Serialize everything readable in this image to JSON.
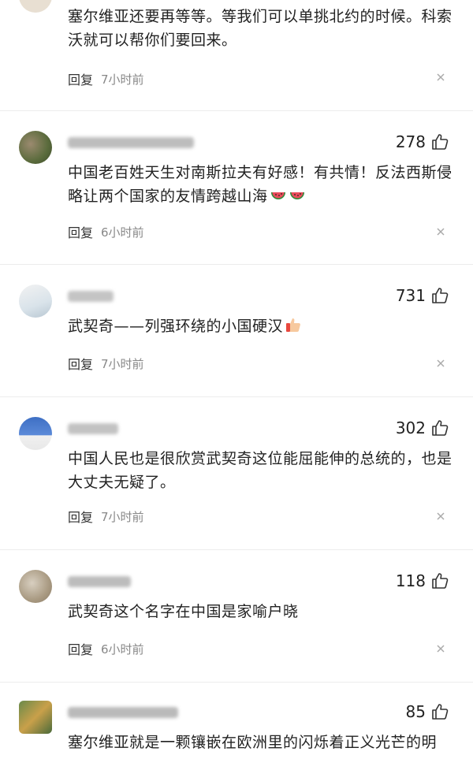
{
  "comments": [
    {
      "text": "塞尔维亚还要再等等。等我们可以单挑北约的时候。科索沃就可以帮你们要回来。",
      "reply_label": "回复",
      "time": "7小时前"
    },
    {
      "likes": "278",
      "text": "中国老百姓天生对南斯拉夫有好感！有共情！反法西斯侵略让两个国家的友情跨越山海",
      "reply_label": "回复",
      "time": "6小时前"
    },
    {
      "likes": "731",
      "text": "武契奇——列强环绕的小国硬汉",
      "reply_label": "回复",
      "time": "7小时前"
    },
    {
      "likes": "302",
      "text": "中国人民也是很欣赏武契奇这位能屈能伸的总统的，也是大丈夫无疑了。",
      "reply_label": "回复",
      "time": "7小时前"
    },
    {
      "likes": "118",
      "text": "武契奇这个名字在中国是家喻户晓",
      "reply_label": "回复",
      "time": "6小时前"
    },
    {
      "likes": "85",
      "text": "塞尔维亚就是一颗镶嵌在欧洲里的闪烁着正义光芒的明"
    }
  ],
  "icons": {
    "like": "thumbs-up-icon",
    "close": "close-icon",
    "watermelon": "watermelon-emoji",
    "thumbs_up_emoji": "thumbs-up-emoji"
  },
  "colors": {
    "text": "#222222",
    "meta": "#888888",
    "separator": "#ececec"
  }
}
